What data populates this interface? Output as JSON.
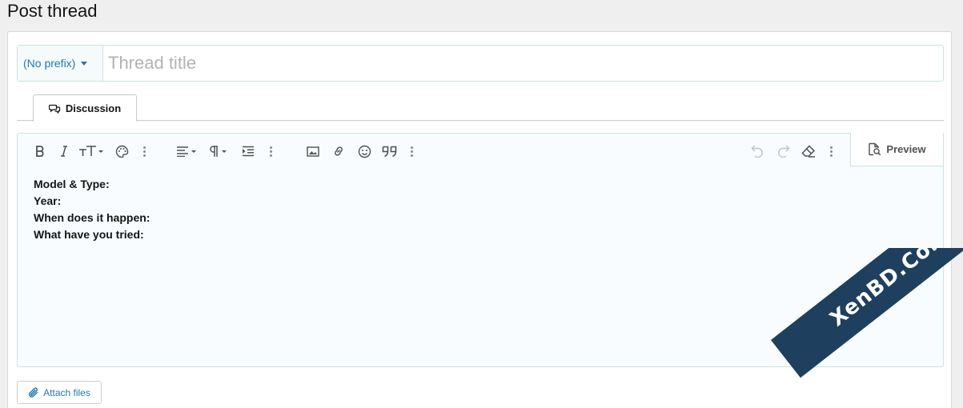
{
  "page": {
    "title": "Post thread"
  },
  "form": {
    "prefix_label": "(No prefix)",
    "title_placeholder": "Thread title"
  },
  "tabs": [
    {
      "label": "Discussion",
      "icon": "comments-icon"
    }
  ],
  "toolbar": {
    "groups": [
      [
        "bold-icon",
        "italic-icon",
        "font-size-icon",
        "text-color-icon",
        "more-text-icon"
      ],
      [
        "align-icon",
        "paragraph-icon",
        "indent-icon",
        "more-paragraph-icon"
      ],
      [
        "image-icon",
        "link-icon",
        "smilie-icon",
        "quote-icon",
        "more-insert-icon"
      ],
      [
        "undo-icon",
        "redo-icon",
        "clear-formatting-icon",
        "more-misc-icon"
      ]
    ],
    "preview_label": "Preview"
  },
  "editor": {
    "lines": [
      "Model & Type:",
      "Year:",
      "When does it happen:",
      "What have you tried:"
    ]
  },
  "attach": {
    "label": "Attach files"
  },
  "watermark": {
    "text": "XenBD.Com"
  },
  "colors": {
    "accent": "#2577b1",
    "ribbon": "#1f3f5e"
  }
}
